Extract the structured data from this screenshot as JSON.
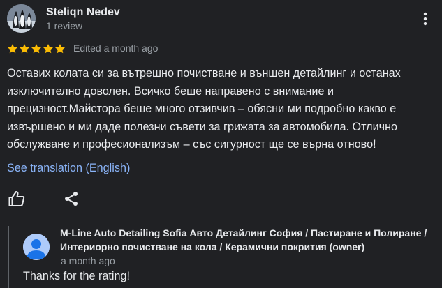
{
  "review": {
    "reviewer_name": "Steliqn Nedev",
    "review_count": "1 review",
    "rating": 5,
    "rating_max": 5,
    "star_color": "#fbbc04",
    "edited_label": "Edited a month ago",
    "text": "Оставих колата си за вътрешно почистване и външен детайлинг и останах изключително доволен. Всичко беше направено с внимание и прецизност.Майстора беше много отзивчив – обясни ми подробно какво е извършено и ми даде полезни съвети за грижата за автомобила. Отлично обслужване и професионализъм – със сигурност ще се върна отново!",
    "translation_link": "See translation (English)",
    "icons": {
      "more": "more-vert-icon",
      "like": "thumb-up-icon",
      "share": "share-icon"
    }
  },
  "owner_response": {
    "owner_name": "M-Line Auto Detailing Sofia Авто Детайлинг София / Пастиране и Полиране / Интериорно почистване на кола / Керамични покрития (owner)",
    "time": "a month ago",
    "text": "Thanks for the rating!",
    "avatar_icon": "default-person-avatar"
  },
  "colors": {
    "background": "#202124",
    "primary_text": "#e8eaed",
    "secondary_text": "#9aa0a6",
    "link": "#8ab4f8",
    "owner_avatar_bg": "#aecbfa",
    "owner_avatar_fg": "#1a73e8"
  }
}
